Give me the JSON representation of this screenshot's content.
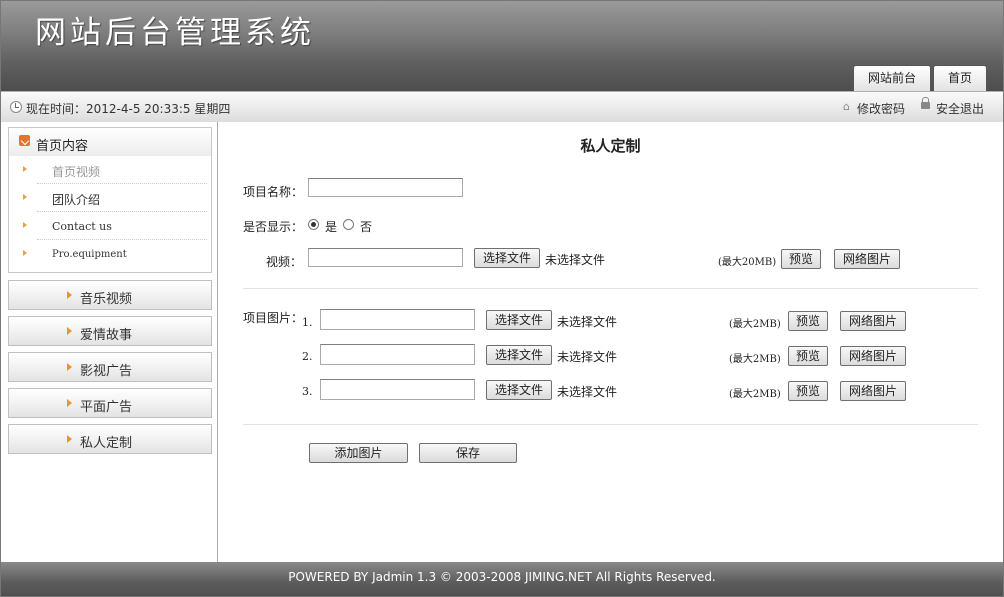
{
  "header": {
    "title": "网站后台管理系统",
    "tabs": [
      "网站前台",
      "首页"
    ]
  },
  "status": {
    "time": "现在时间：2012-4-5 20:33:5 星期四",
    "change_password": "修改密码",
    "logout": "安全退出"
  },
  "sidebar": {
    "open_menu": {
      "title": "首页内容",
      "items": [
        "首页视频",
        "团队介绍",
        "Contact us",
        "Pro.equipment"
      ]
    },
    "menus": [
      "音乐视频",
      "爱情故事",
      "影视广告",
      "平面广告",
      "私人定制"
    ]
  },
  "form": {
    "title": "私人定制",
    "name_label": "项目名称：",
    "name_value": "",
    "show_label": "是否显示：",
    "show_yes": "是",
    "show_no": "否",
    "video_label": "视频：",
    "choose_file": "选择文件",
    "no_file": "未选择文件",
    "video_max": "(最大20MB)",
    "preview": "预览",
    "net_image": "网络图片",
    "image_label": "项目图片：",
    "image_rows": [
      {
        "index": "1.",
        "max": "(最大2MB)"
      },
      {
        "index": "2.",
        "max": "(最大2MB)"
      },
      {
        "index": "3.",
        "max": "(最大2MB)"
      }
    ],
    "add_image": "添加图片",
    "save": "保存"
  },
  "footer": {
    "text": "POWERED BY Jadmin 1.3 © 2003-2008 JIMING.NET All Rights Reserved."
  }
}
